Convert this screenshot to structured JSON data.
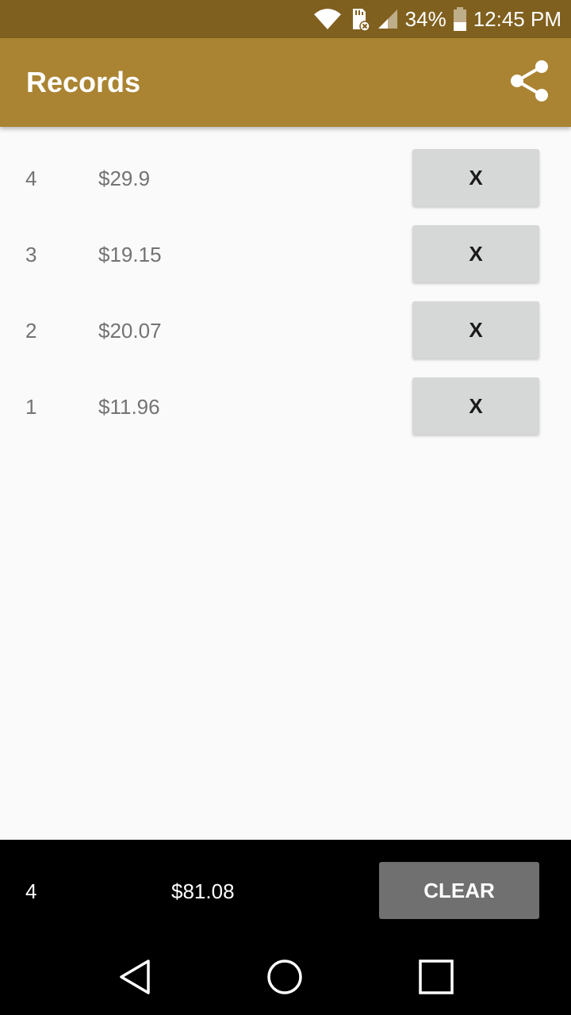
{
  "status_bar": {
    "battery_percent": "34%",
    "time": "12:45 PM",
    "icons": [
      "wifi-icon",
      "sd-card-error-icon",
      "cell-signal-icon",
      "battery-icon"
    ]
  },
  "app_bar": {
    "title": "Records",
    "share_icon": "share-icon"
  },
  "records": [
    {
      "index": "4",
      "amount": "$29.9",
      "delete_label": "X"
    },
    {
      "index": "3",
      "amount": "$19.15",
      "delete_label": "X"
    },
    {
      "index": "2",
      "amount": "$20.07",
      "delete_label": "X"
    },
    {
      "index": "1",
      "amount": "$11.96",
      "delete_label": "X"
    }
  ],
  "footer": {
    "count": "4",
    "total": "$81.08",
    "clear_label": "CLEAR"
  },
  "nav_bar": {
    "buttons": [
      "back-icon",
      "home-icon",
      "recents-icon"
    ]
  },
  "colors": {
    "status_bar": "#80601f",
    "app_bar": "#aa8433",
    "background": "#fafafa",
    "delete_button": "#d6d7d7",
    "clear_button": "#707070",
    "footer": "#000000"
  }
}
